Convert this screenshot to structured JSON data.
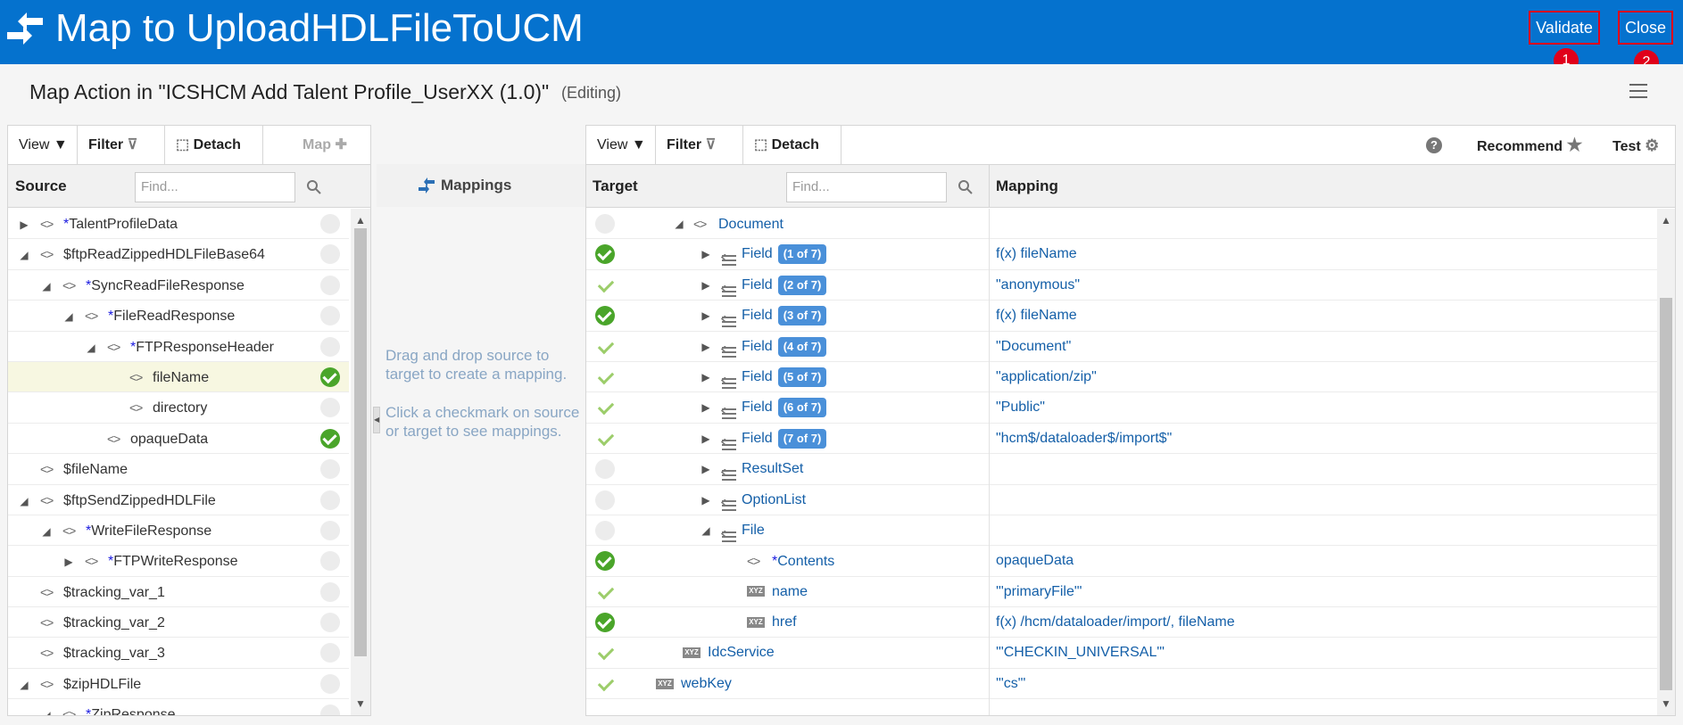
{
  "header": {
    "title": "Map to UploadHDLFileToUCM",
    "validate_label": "Validate",
    "close_label": "Close",
    "validate_badge": "1",
    "close_badge": "2"
  },
  "subheader": {
    "title": "Map Action in \"ICSHCM Add Talent Profile_UserXX (1.0)\"",
    "status": "(Editing)"
  },
  "source": {
    "toolbar": {
      "view": "View",
      "filter": "Filter",
      "detach": "Detach",
      "map": "Map"
    },
    "header": "Source",
    "find_placeholder": "Find...",
    "rows": [
      {
        "label": "TalentProfileData",
        "star": true,
        "expand": "collapsed",
        "level": 0,
        "status": "none"
      },
      {
        "label": "$ftpReadZippedHDLFileBase64",
        "star": false,
        "expand": "expanded",
        "level": 0,
        "status": "none"
      },
      {
        "label": "SyncReadFileResponse",
        "star": true,
        "expand": "expanded",
        "level": 1,
        "status": "none"
      },
      {
        "label": "FileReadResponse",
        "star": true,
        "expand": "expanded",
        "level": 2,
        "status": "none"
      },
      {
        "label": "FTPResponseHeader",
        "star": true,
        "expand": "expanded",
        "level": 3,
        "status": "none"
      },
      {
        "label": "fileName",
        "star": false,
        "expand": "none",
        "level": 4,
        "status": "mapped",
        "highlight": true
      },
      {
        "label": "directory",
        "star": false,
        "expand": "none",
        "level": 4,
        "status": "none"
      },
      {
        "label": "opaqueData",
        "star": false,
        "expand": "none",
        "level": 3,
        "status": "mapped"
      },
      {
        "label": "$fileName",
        "star": false,
        "expand": "none",
        "level": 0,
        "status": "none"
      },
      {
        "label": "$ftpSendZippedHDLFile",
        "star": false,
        "expand": "expanded",
        "level": 0,
        "status": "none"
      },
      {
        "label": "WriteFileResponse",
        "star": true,
        "expand": "expanded",
        "level": 1,
        "status": "none"
      },
      {
        "label": "FTPWriteResponse",
        "star": true,
        "expand": "collapsed",
        "level": 2,
        "status": "none"
      },
      {
        "label": "$tracking_var_1",
        "star": false,
        "expand": "none",
        "level": 0,
        "status": "none"
      },
      {
        "label": "$tracking_var_2",
        "star": false,
        "expand": "none",
        "level": 0,
        "status": "none"
      },
      {
        "label": "$tracking_var_3",
        "star": false,
        "expand": "none",
        "level": 0,
        "status": "none"
      },
      {
        "label": "$zipHDLFile",
        "star": false,
        "expand": "expanded",
        "level": 0,
        "status": "none"
      },
      {
        "label": "ZipResponse",
        "star": true,
        "expand": "expanded",
        "level": 1,
        "status": "none"
      }
    ]
  },
  "mappings": {
    "header": "Mappings",
    "hint1": "Drag and drop source to target to create a mapping.",
    "hint2": "Click a checkmark on source or target to see mappings."
  },
  "target": {
    "toolbar": {
      "view": "View",
      "filter": "Filter",
      "detach": "Detach",
      "recommend": "Recommend",
      "test": "Test"
    },
    "header": "Target",
    "mapping_header": "Mapping",
    "find_placeholder": "Find...",
    "rows": [
      {
        "label": "Document",
        "kind": "element",
        "expand": "expanded",
        "level": 0,
        "status": "none",
        "mapping": ""
      },
      {
        "label": "Field",
        "kind": "repeat",
        "pill": "(1 of 7)",
        "expand": "collapsed",
        "level": 1,
        "status": "solid",
        "mapping": "f(x) fileName"
      },
      {
        "label": "Field",
        "kind": "repeat",
        "pill": "(2 of 7)",
        "expand": "collapsed",
        "level": 1,
        "status": "light",
        "mapping": "\"anonymous\""
      },
      {
        "label": "Field",
        "kind": "repeat",
        "pill": "(3 of 7)",
        "expand": "collapsed",
        "level": 1,
        "status": "solid",
        "mapping": "f(x) fileName"
      },
      {
        "label": "Field",
        "kind": "repeat",
        "pill": "(4 of 7)",
        "expand": "collapsed",
        "level": 1,
        "status": "light",
        "mapping": "\"Document\""
      },
      {
        "label": "Field",
        "kind": "repeat",
        "pill": "(5 of 7)",
        "expand": "collapsed",
        "level": 1,
        "status": "light",
        "mapping": "\"application/zip\""
      },
      {
        "label": "Field",
        "kind": "repeat",
        "pill": "(6 of 7)",
        "expand": "collapsed",
        "level": 1,
        "status": "light",
        "mapping": "\"Public\""
      },
      {
        "label": "Field",
        "kind": "repeat",
        "pill": "(7 of 7)",
        "expand": "collapsed",
        "level": 1,
        "status": "light",
        "mapping": "\"hcm$/dataloader$/import$\""
      },
      {
        "label": "ResultSet",
        "kind": "repeat",
        "expand": "collapsed",
        "level": 1,
        "status": "none",
        "mapping": ""
      },
      {
        "label": "OptionList",
        "kind": "repeat",
        "expand": "collapsed",
        "level": 1,
        "status": "none",
        "mapping": ""
      },
      {
        "label": "File",
        "kind": "repeat",
        "expand": "expanded",
        "level": 1,
        "status": "none",
        "mapping": ""
      },
      {
        "label": "Contents",
        "kind": "element",
        "star": true,
        "expand": "none",
        "level": 2,
        "status": "solid",
        "mapping": "opaqueData"
      },
      {
        "label": "name",
        "kind": "attr",
        "expand": "none",
        "level": 2,
        "status": "light",
        "mapping": "'\"primaryFile\"'"
      },
      {
        "label": "href",
        "kind": "attr",
        "expand": "none",
        "level": 2,
        "status": "solid",
        "mapping": "f(x) /hcm/dataloader/import/, fileName"
      },
      {
        "label": "IdcService",
        "kind": "attr",
        "expand": "none",
        "level": -0.4,
        "status": "light",
        "mapping": "'\"CHECKIN_UNIVERSAL\"'"
      },
      {
        "label": "webKey",
        "kind": "attr",
        "expand": "none",
        "level": -1.4,
        "status": "light",
        "mapping": "'\"cs\"'"
      }
    ]
  }
}
